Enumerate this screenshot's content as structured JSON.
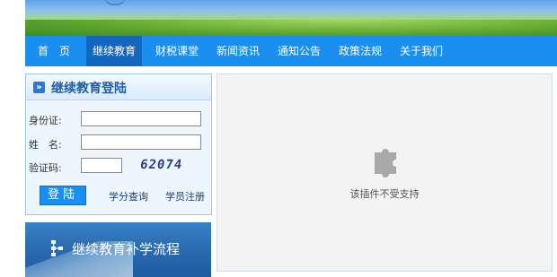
{
  "nav": {
    "items": [
      {
        "label": "首　页"
      },
      {
        "label": "继续教育"
      },
      {
        "label": "财税课堂"
      },
      {
        "label": "新闻资讯"
      },
      {
        "label": "通知公告"
      },
      {
        "label": "政策法规"
      },
      {
        "label": "关于我们"
      }
    ],
    "active_index": 1
  },
  "login": {
    "title": "继续教育登陆",
    "id_label": "身份证:",
    "name_label": "姓　名:",
    "captcha_label": "验证码:",
    "id_value": "",
    "name_value": "",
    "captcha_value": "",
    "captcha_image_text": "62074",
    "submit_label": "登陆",
    "credit_query_link": "学分查询",
    "register_link": "学员注册"
  },
  "flow_banner": {
    "label": "继续教育补学流程",
    "icon": "flowchart-icon"
  },
  "plugin": {
    "message": "该插件不受支持",
    "icon": "puzzle-icon"
  },
  "colors": {
    "nav_bg": "#1a8ff0",
    "nav_active": "#1467bf",
    "panel_border": "#9cc6ec"
  }
}
